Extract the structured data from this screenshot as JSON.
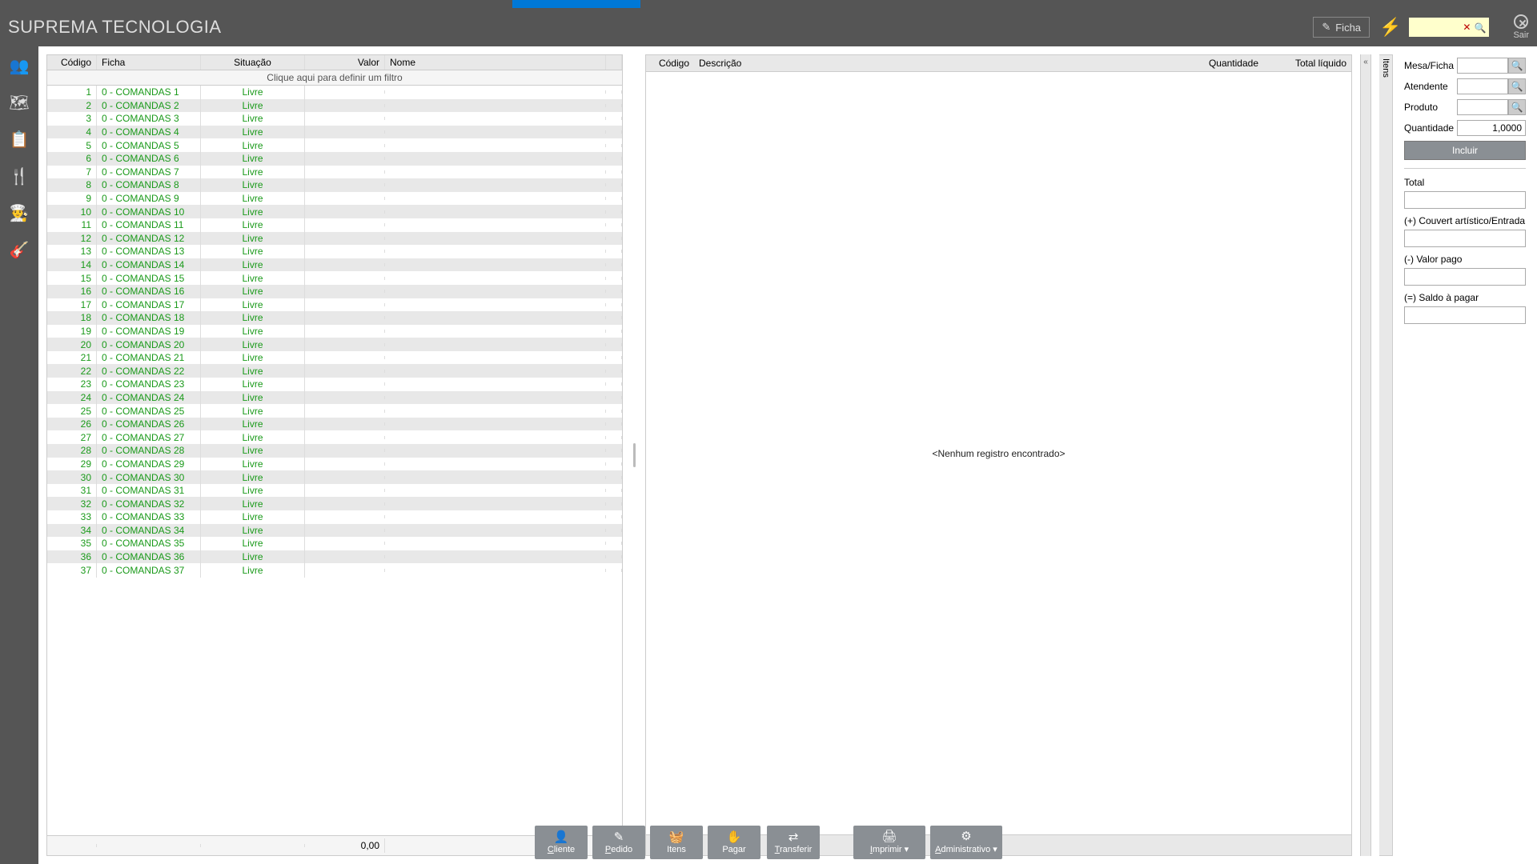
{
  "brand": "SUPREMA TECNOLOGIA",
  "header": {
    "ficha_label": "Ficha",
    "sair_label": "Sair"
  },
  "sidebar": {
    "items": [
      {
        "name": "people-icon"
      },
      {
        "name": "map-icon"
      },
      {
        "name": "clipboard-icon"
      },
      {
        "name": "fork-knife-icon"
      },
      {
        "name": "chef-hat-icon"
      },
      {
        "name": "guitar-icon",
        "active": true
      }
    ]
  },
  "grid": {
    "headers": {
      "codigo": "Código",
      "ficha": "Ficha",
      "situacao": "Situação",
      "valor": "Valor",
      "nome": "Nome"
    },
    "filter_placeholder": "Clique aqui para definir um filtro",
    "rows": [
      {
        "codigo": "1",
        "ficha": "0 - COMANDAS 1",
        "situacao": "Livre"
      },
      {
        "codigo": "2",
        "ficha": "0 - COMANDAS 2",
        "situacao": "Livre"
      },
      {
        "codigo": "3",
        "ficha": "0 - COMANDAS 3",
        "situacao": "Livre"
      },
      {
        "codigo": "4",
        "ficha": "0 - COMANDAS 4",
        "situacao": "Livre"
      },
      {
        "codigo": "5",
        "ficha": "0 - COMANDAS 5",
        "situacao": "Livre"
      },
      {
        "codigo": "6",
        "ficha": "0 - COMANDAS 6",
        "situacao": "Livre"
      },
      {
        "codigo": "7",
        "ficha": "0 - COMANDAS 7",
        "situacao": "Livre"
      },
      {
        "codigo": "8",
        "ficha": "0 - COMANDAS 8",
        "situacao": "Livre"
      },
      {
        "codigo": "9",
        "ficha": "0 - COMANDAS 9",
        "situacao": "Livre"
      },
      {
        "codigo": "10",
        "ficha": "0 - COMANDAS 10",
        "situacao": "Livre"
      },
      {
        "codigo": "11",
        "ficha": "0 - COMANDAS 11",
        "situacao": "Livre"
      },
      {
        "codigo": "12",
        "ficha": "0 - COMANDAS 12",
        "situacao": "Livre"
      },
      {
        "codigo": "13",
        "ficha": "0 - COMANDAS 13",
        "situacao": "Livre"
      },
      {
        "codigo": "14",
        "ficha": "0 - COMANDAS 14",
        "situacao": "Livre"
      },
      {
        "codigo": "15",
        "ficha": "0 - COMANDAS 15",
        "situacao": "Livre"
      },
      {
        "codigo": "16",
        "ficha": "0 - COMANDAS 16",
        "situacao": "Livre"
      },
      {
        "codigo": "17",
        "ficha": "0 - COMANDAS 17",
        "situacao": "Livre"
      },
      {
        "codigo": "18",
        "ficha": "0 - COMANDAS 18",
        "situacao": "Livre"
      },
      {
        "codigo": "19",
        "ficha": "0 - COMANDAS 19",
        "situacao": "Livre"
      },
      {
        "codigo": "20",
        "ficha": "0 - COMANDAS 20",
        "situacao": "Livre"
      },
      {
        "codigo": "21",
        "ficha": "0 - COMANDAS 21",
        "situacao": "Livre"
      },
      {
        "codigo": "22",
        "ficha": "0 - COMANDAS 22",
        "situacao": "Livre"
      },
      {
        "codigo": "23",
        "ficha": "0 - COMANDAS 23",
        "situacao": "Livre"
      },
      {
        "codigo": "24",
        "ficha": "0 - COMANDAS 24",
        "situacao": "Livre"
      },
      {
        "codigo": "25",
        "ficha": "0 - COMANDAS 25",
        "situacao": "Livre"
      },
      {
        "codigo": "26",
        "ficha": "0 - COMANDAS 26",
        "situacao": "Livre"
      },
      {
        "codigo": "27",
        "ficha": "0 - COMANDAS 27",
        "situacao": "Livre"
      },
      {
        "codigo": "28",
        "ficha": "0 - COMANDAS 28",
        "situacao": "Livre"
      },
      {
        "codigo": "29",
        "ficha": "0 - COMANDAS 29",
        "situacao": "Livre"
      },
      {
        "codigo": "30",
        "ficha": "0 - COMANDAS 30",
        "situacao": "Livre"
      },
      {
        "codigo": "31",
        "ficha": "0 - COMANDAS 31",
        "situacao": "Livre"
      },
      {
        "codigo": "32",
        "ficha": "0 - COMANDAS 32",
        "situacao": "Livre"
      },
      {
        "codigo": "33",
        "ficha": "0 - COMANDAS 33",
        "situacao": "Livre"
      },
      {
        "codigo": "34",
        "ficha": "0 - COMANDAS 34",
        "situacao": "Livre"
      },
      {
        "codigo": "35",
        "ficha": "0 - COMANDAS 35",
        "situacao": "Livre"
      },
      {
        "codigo": "36",
        "ficha": "0 - COMANDAS 36",
        "situacao": "Livre"
      },
      {
        "codigo": "37",
        "ficha": "0 - COMANDAS 37",
        "situacao": "Livre"
      }
    ],
    "footer_valor": "0,00"
  },
  "items_panel": {
    "headers": {
      "codigo": "Código",
      "descricao": "Descrição",
      "quantidade": "Quantidade",
      "total": "Total líquido"
    },
    "empty": "<Nenhum registro encontrado>",
    "vtab": "Itens",
    "collapse": "«"
  },
  "form": {
    "mesa_label": "Mesa/Ficha",
    "atendente_label": "Atendente",
    "produto_label": "Produto",
    "quantidade_label": "Quantidade",
    "quantidade_value": "1,0000",
    "incluir": "Incluir",
    "total_label": "Total",
    "couvert_label": "(+) Couvert artístico/Entrada",
    "valor_pago_label": "(-) Valor pago",
    "saldo_label": "(=) Saldo à pagar"
  },
  "bottombar": {
    "cliente": "Cliente",
    "pedido": "Pedido",
    "itens": "Itens",
    "pagar": "Pagar",
    "transferir": "Transferir",
    "imprimir": "Imprimir",
    "administrativo": "Administrativo"
  }
}
